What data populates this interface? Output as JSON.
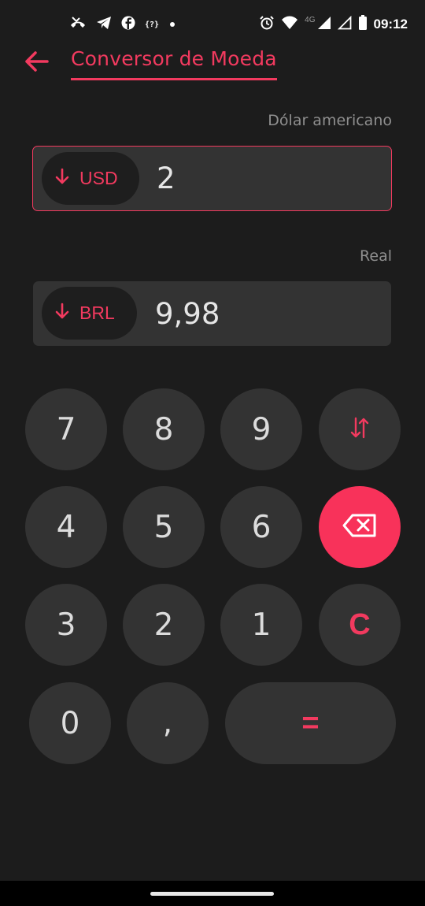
{
  "status_bar": {
    "time": "09:12",
    "network": "4G",
    "left_icons": [
      "missed-call-icon",
      "telegram-icon",
      "facebook-icon",
      "unknown-app-icon",
      "dot-icon"
    ],
    "right_icons": [
      "alarm-icon",
      "wifi-icon",
      "signal-icon",
      "signal-empty-icon",
      "battery-icon"
    ],
    "unknown_app_label": "{?}"
  },
  "app_bar": {
    "title": "Conversor de Moeda",
    "back_icon": "arrow-left-icon"
  },
  "converter": {
    "from": {
      "currency_name": "Dólar americano",
      "code": "USD",
      "value": "2",
      "icon": "arrow-down-icon"
    },
    "to": {
      "currency_name": "Real",
      "code": "BRL",
      "value": "9,98",
      "icon": "arrow-down-icon"
    }
  },
  "keypad": {
    "rows": [
      [
        "7",
        "8",
        "9",
        "swap"
      ],
      [
        "4",
        "5",
        "6",
        "backspace"
      ],
      [
        "3",
        "2",
        "1",
        "C"
      ],
      [
        "0",
        ",",
        "="
      ]
    ],
    "k7": "7",
    "k8": "8",
    "k9": "9",
    "k4": "4",
    "k5": "5",
    "k6": "6",
    "k3": "3",
    "k2": "2",
    "k1": "1",
    "k0": "0",
    "comma": ",",
    "equals": "=",
    "clear": "C",
    "swap_icon": "swap-vertical-icon",
    "backspace_icon": "backspace-icon"
  },
  "colors": {
    "accent": "#f23a5f",
    "background": "#1c1c1c",
    "surface": "#333333",
    "backspace_bg": "#f8325a"
  }
}
